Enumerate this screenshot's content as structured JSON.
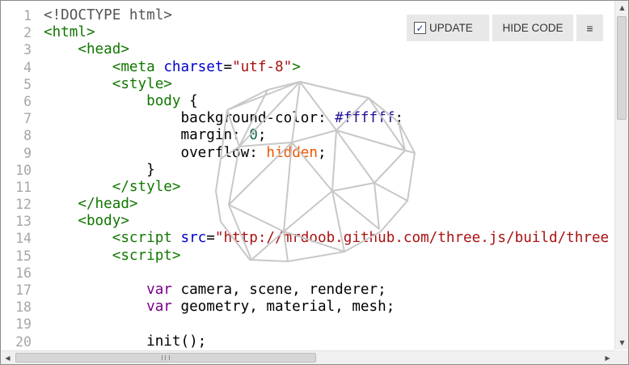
{
  "toolbar": {
    "update_label": "UPDATE",
    "update_checked": true,
    "hide_code_label": "HIDE CODE",
    "menu_label": "≡"
  },
  "editor": {
    "line_numbers": [
      "1",
      "2",
      "3",
      "4",
      "5",
      "6",
      "7",
      "8",
      "9",
      "10",
      "11",
      "12",
      "13",
      "14",
      "15",
      "16",
      "17",
      "18",
      "19",
      "20"
    ],
    "lines": [
      [
        {
          "t": "<!DOCTYPE html>",
          "c": "def"
        }
      ],
      [
        {
          "t": "<html>",
          "c": "tag"
        }
      ],
      [
        {
          "t": "    "
        },
        {
          "t": "<head>",
          "c": "tag"
        }
      ],
      [
        {
          "t": "        "
        },
        {
          "t": "<meta",
          "c": "tag"
        },
        {
          "t": " "
        },
        {
          "t": "charset",
          "c": "attr"
        },
        {
          "t": "="
        },
        {
          "t": "\"utf-8\"",
          "c": "str"
        },
        {
          "t": ">",
          "c": "tag"
        }
      ],
      [
        {
          "t": "        "
        },
        {
          "t": "<style>",
          "c": "tag"
        }
      ],
      [
        {
          "t": "            "
        },
        {
          "t": "body",
          "c": "tag"
        },
        {
          "t": " {"
        }
      ],
      [
        {
          "t": "                "
        },
        {
          "t": "background-color",
          "c": "prop"
        },
        {
          "t": ": "
        },
        {
          "t": "#ffffff",
          "c": "hex"
        },
        {
          "t": ";"
        }
      ],
      [
        {
          "t": "                "
        },
        {
          "t": "margin",
          "c": "prop"
        },
        {
          "t": ": "
        },
        {
          "t": "0",
          "c": "num"
        },
        {
          "t": ";"
        }
      ],
      [
        {
          "t": "                "
        },
        {
          "t": "overflow",
          "c": "prop"
        },
        {
          "t": ": "
        },
        {
          "t": "hidden",
          "c": "atom"
        },
        {
          "t": ";"
        }
      ],
      [
        {
          "t": "            }"
        }
      ],
      [
        {
          "t": "        "
        },
        {
          "t": "</style>",
          "c": "tag"
        }
      ],
      [
        {
          "t": "    "
        },
        {
          "t": "</head>",
          "c": "tag"
        }
      ],
      [
        {
          "t": "    "
        },
        {
          "t": "<body>",
          "c": "tag"
        }
      ],
      [
        {
          "t": "        "
        },
        {
          "t": "<script",
          "c": "tag"
        },
        {
          "t": " "
        },
        {
          "t": "src",
          "c": "attr"
        },
        {
          "t": "="
        },
        {
          "t": "\"http://mrdoob.github.com/three.js/build/three",
          "c": "str"
        }
      ],
      [
        {
          "t": "        "
        },
        {
          "t": "<script>",
          "c": "tag"
        }
      ],
      [
        {
          "t": ""
        }
      ],
      [
        {
          "t": "            "
        },
        {
          "t": "var",
          "c": "kw"
        },
        {
          "t": " camera, scene, renderer;"
        }
      ],
      [
        {
          "t": "            "
        },
        {
          "t": "var",
          "c": "kw"
        },
        {
          "t": " geometry, material, mesh;"
        }
      ],
      [
        {
          "t": ""
        }
      ],
      [
        {
          "t": "            init();"
        }
      ]
    ]
  },
  "colors": {
    "tag": "#117700",
    "attr": "#0000cc",
    "string": "#aa1111",
    "keyword": "#770088",
    "atom": "#ee5500",
    "number": "#116644",
    "hex": "#221199",
    "line_number": "#a6a6a6",
    "mesh_stroke": "#c8c8c8",
    "button_bg": "#e8e8e8"
  },
  "scrollbars": {
    "up_icon": "arrow-up-icon",
    "down_icon": "arrow-down-icon",
    "left_icon": "arrow-left-icon",
    "right_icon": "arrow-right-icon"
  }
}
